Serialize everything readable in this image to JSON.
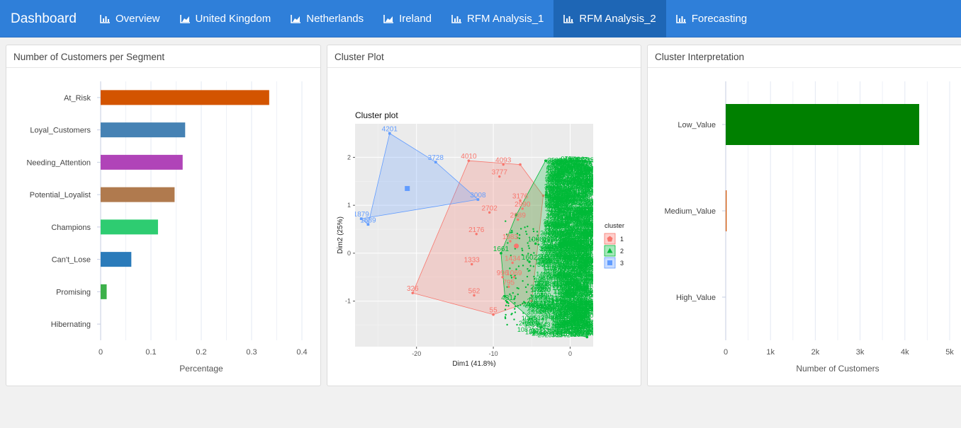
{
  "app": {
    "title": "Dashboard"
  },
  "nav": {
    "items": [
      {
        "label": "Overview",
        "icon": "bar-chart-icon",
        "active": false
      },
      {
        "label": "United Kingdom",
        "icon": "area-chart-icon",
        "active": false
      },
      {
        "label": "Netherlands",
        "icon": "area-chart-icon",
        "active": false
      },
      {
        "label": "Ireland",
        "icon": "area-chart-icon",
        "active": false
      },
      {
        "label": "RFM Analysis_1",
        "icon": "bar-chart-icon",
        "active": false
      },
      {
        "label": "RFM Analysis_2",
        "icon": "bar-chart-icon",
        "active": true
      },
      {
        "label": "Forecasting",
        "icon": "bar-chart-icon",
        "active": false
      }
    ]
  },
  "panels": {
    "segments": {
      "title": "Number of Customers per Segment"
    },
    "cluster_plot": {
      "title": "Cluster Plot"
    },
    "interpretation": {
      "title": "Cluster Interpretation"
    }
  },
  "chart_data": [
    {
      "id": "segments",
      "type": "bar",
      "orientation": "horizontal",
      "categories": [
        "At_Risk",
        "Loyal_Customers",
        "Needing_Attention",
        "Potential_Loyalist",
        "Champions",
        "Can't_Lose",
        "Promising",
        "Hibernating"
      ],
      "values": [
        0.335,
        0.168,
        0.163,
        0.147,
        0.114,
        0.061,
        0.012,
        0.0
      ],
      "colors": [
        "#d35400",
        "#4682b4",
        "#b044b8",
        "#b07a4e",
        "#2ecc71",
        "#2b7bba",
        "#3cb04a",
        "#888888"
      ],
      "xlabel": "Percentage",
      "ylabel": "",
      "xlim": [
        0,
        0.4
      ],
      "xticks": [
        "0",
        "0.1",
        "0.2",
        "0.3",
        "0.4"
      ],
      "grid": true
    },
    {
      "id": "cluster",
      "type": "scatter",
      "title": "Cluster plot",
      "xlabel": "Dim1 (41.8%)",
      "ylabel": "Dim2 (25%)",
      "xlim": [
        -28,
        3
      ],
      "ylim": [
        -1.95,
        2.7
      ],
      "xticks": [
        "-20",
        "-10",
        "0"
      ],
      "yticks": [
        "2",
        "1",
        "0",
        "-1"
      ],
      "legend": {
        "title": "cluster",
        "position": "right",
        "entries": [
          "1",
          "2",
          "3"
        ]
      },
      "series": [
        {
          "name": "1",
          "color": "#f8766d",
          "hull": [
            [
              -13.2,
              1.93
            ],
            [
              -6.5,
              1.85
            ],
            [
              -3.5,
              1.2
            ],
            [
              -5,
              -1.0
            ],
            [
              -10,
              -1.28
            ],
            [
              -20.5,
              -0.83
            ]
          ],
          "center": [
            -7.0,
            0.15
          ],
          "points": [
            {
              "label": "4010",
              "x": -13.2,
              "y": 1.93
            },
            {
              "label": "4093",
              "x": -8.7,
              "y": 1.85
            },
            {
              "label": "3777",
              "x": -9.2,
              "y": 1.6
            },
            {
              "label": "3176",
              "x": -6.5,
              "y": 1.1
            },
            {
              "label": "2702",
              "x": -10.5,
              "y": 0.85
            },
            {
              "label": "2990",
              "x": -6.2,
              "y": 0.93
            },
            {
              "label": "2689",
              "x": -6.8,
              "y": 0.7
            },
            {
              "label": "2176",
              "x": -12.2,
              "y": 0.4
            },
            {
              "label": "1983",
              "x": -7.8,
              "y": 0.25
            },
            {
              "label": "1333",
              "x": -12.8,
              "y": -0.23
            },
            {
              "label": "1434",
              "x": -7.5,
              "y": -0.2
            },
            {
              "label": "996",
              "x": -8.8,
              "y": -0.5
            },
            {
              "label": "1069",
              "x": -7.3,
              "y": -0.5
            },
            {
              "label": "795",
              "x": -8.0,
              "y": -0.7
            },
            {
              "label": "326",
              "x": -20.5,
              "y": -0.83
            },
            {
              "label": "562",
              "x": -12.5,
              "y": -0.88
            },
            {
              "label": "55",
              "x": -10.0,
              "y": -1.28
            }
          ]
        },
        {
          "name": "2",
          "color": "#00ba38",
          "hull": [
            [
              -3.2,
              1.93
            ],
            [
              2.0,
              1.93
            ],
            [
              2.2,
              -1.75
            ],
            [
              -3.8,
              -1.55
            ],
            [
              -8.5,
              -0.9
            ],
            [
              -9.0,
              0.0
            ],
            [
              -7.0,
              0.8
            ]
          ],
          "center": [
            -1.0,
            0.15
          ],
          "points": [
            {
              "label": "1661",
              "x": -9.0,
              "y": 0.0
            },
            {
              "label": "1602",
              "x": -5.3,
              "y": -0.18
            },
            {
              "label": "1008",
              "x": -4.5,
              "y": 0.2
            },
            {
              "label": "481",
              "x": -8.2,
              "y": -1.02
            }
          ]
        },
        {
          "name": "3",
          "color": "#619cff",
          "hull": [
            [
              -23.5,
              2.5
            ],
            [
              -17.5,
              1.9
            ],
            [
              -12,
              1.12
            ],
            [
              -27.2,
              0.72
            ],
            [
              -26.3,
              0.6
            ]
          ],
          "center": [
            -21.2,
            1.35
          ],
          "points": [
            {
              "label": "4201",
              "x": -23.5,
              "y": 2.5
            },
            {
              "label": "3728",
              "x": -17.5,
              "y": 1.9
            },
            {
              "label": "3008",
              "x": -12.0,
              "y": 1.12
            },
            {
              "label": "1879",
              "x": -27.2,
              "y": 0.72
            },
            {
              "label": "1689",
              "x": -26.3,
              "y": 0.6
            }
          ]
        }
      ]
    },
    {
      "id": "interpretation",
      "type": "bar",
      "orientation": "horizontal",
      "categories": [
        "Low_Value",
        "Medium_Value",
        "High_Value"
      ],
      "values": [
        4320,
        20,
        0
      ],
      "colors": [
        "#008000",
        "#d35400",
        "#888888"
      ],
      "xlabel": "Number of Customers",
      "ylabel": "",
      "xlim": [
        0,
        5000
      ],
      "xticks": [
        "0",
        "1k",
        "2k",
        "3k",
        "4k",
        "5k"
      ],
      "grid": true
    }
  ]
}
